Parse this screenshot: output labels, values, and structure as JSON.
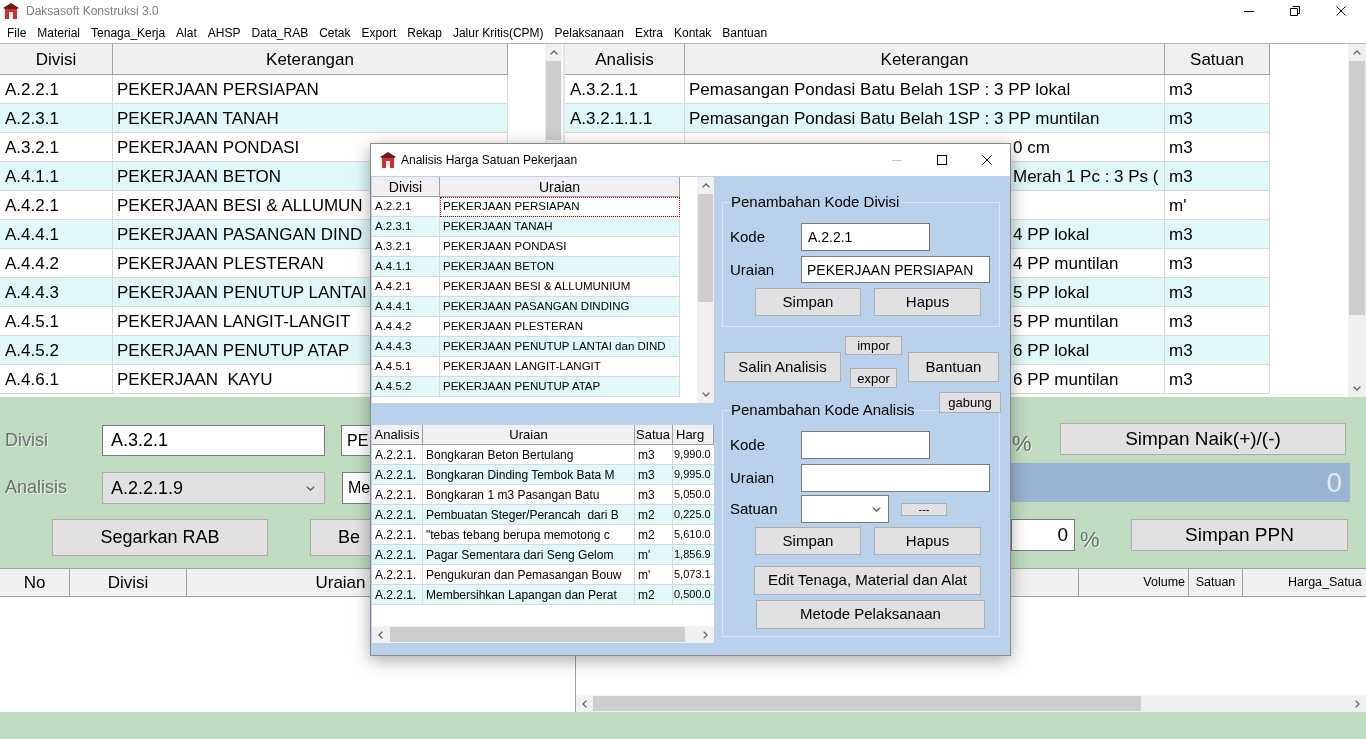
{
  "window": {
    "title": "Daksasoft Konstruksi 3.0"
  },
  "menu": [
    "File",
    "Material",
    "Tenaga_Kerja",
    "Alat",
    "AHSP",
    "Data_RAB",
    "Cetak",
    "Export",
    "Rekap",
    "Jalur Kritis(CPM)",
    "Pelaksanaan",
    "Extra",
    "Kontak",
    "Bantuan"
  ],
  "divisi_table": {
    "columns": [
      "Divisi",
      "Keterangan"
    ],
    "rows": [
      {
        "divisi": "A.2.2.1",
        "keterangan": "PEKERJAAN PERSIAPAN"
      },
      {
        "divisi": "A.2.3.1",
        "keterangan": "PEKERJAAN TANAH"
      },
      {
        "divisi": "A.3.2.1",
        "keterangan": "PEKERJAAN PONDASI"
      },
      {
        "divisi": "A.4.1.1",
        "keterangan": "PEKERJAAN BETON"
      },
      {
        "divisi": "A.4.2.1",
        "keterangan": "PEKERJAAN BESI & ALLUMUN"
      },
      {
        "divisi": "A.4.4.1",
        "keterangan": "PEKERJAAN PASANGAN DIND"
      },
      {
        "divisi": "A.4.4.2",
        "keterangan": "PEKERJAAN PLESTERAN"
      },
      {
        "divisi": "A.4.4.3",
        "keterangan": "PEKERJAAN PENUTUP LANTAI"
      },
      {
        "divisi": "A.4.5.1",
        "keterangan": "PEKERJAAN LANGIT-LANGIT"
      },
      {
        "divisi": "A.4.5.2",
        "keterangan": "PEKERJAAN PENUTUP ATAP"
      },
      {
        "divisi": "A.4.6.1",
        "keterangan": "PEKERJAAN  KAYU"
      }
    ]
  },
  "analisis_table": {
    "columns": [
      "Analisis",
      "Keterangan",
      "Satuan"
    ],
    "rows": [
      {
        "analisis": "A.3.2.1.1",
        "keterangan": "Pemasangan Pondasi Batu Belah 1SP : 3 PP lokal",
        "satuan": "m3"
      },
      {
        "analisis": "A.3.2.1.1.1",
        "keterangan": "Pemasangan Pondasi Batu Belah 1SP : 3 PP muntilan",
        "satuan": "m3"
      },
      {
        "keterangan": "0 cm",
        "satuan": "m3"
      },
      {
        "keterangan": "Merah 1 Pc : 3 Ps (",
        "satuan": "m3"
      },
      {
        "satuan": "m'"
      },
      {
        "keterangan": "4 PP lokal",
        "satuan": "m3"
      },
      {
        "keterangan": "4 PP muntilan",
        "satuan": "m3"
      },
      {
        "keterangan": "5 PP lokal",
        "satuan": "m3"
      },
      {
        "keterangan": "5 PP muntilan",
        "satuan": "m3"
      },
      {
        "keterangan": "6 PP lokal",
        "satuan": "m3"
      },
      {
        "keterangan": "6 PP muntilan",
        "satuan": "m3"
      }
    ]
  },
  "rab_form": {
    "divisi_label": "Divisi",
    "divisi_code": "A.3.2.1",
    "divisi_name": "PE",
    "analisis_label": "Analisis",
    "analisis_code": "A.2.2.1.9",
    "analisis_name": "Me",
    "refresh_button": "Segarkan RAB",
    "button_2": "Be",
    "increase_unit": "%",
    "increase_button": "Simpan Naik(+)/(-)",
    "total": "0",
    "ppn_value": "0",
    "ppn_unit": "%",
    "ppn_button": "Simpan PPN"
  },
  "rab_table": {
    "left_columns": [
      "No",
      "Divisi",
      "Uraian"
    ],
    "right_columns": [
      "Volume",
      "Satuan",
      "Harga_Satua"
    ]
  },
  "dialog": {
    "title": "Analisis Harga Satuan Pekerjaan",
    "divisi_table": {
      "columns": [
        "Divisi",
        "Uraian"
      ],
      "rows": [
        {
          "divisi": "A.2.2.1",
          "uraian": "PEKERJAAN PERSIAPAN",
          "selected": true
        },
        {
          "divisi": "A.2.3.1",
          "uraian": "PEKERJAAN TANAH",
          "selected": false
        },
        {
          "divisi": "A.3.2.1",
          "uraian": "PEKERJAAN PONDASI",
          "selected": false
        },
        {
          "divisi": "A.4.1.1",
          "uraian": "PEKERJAAN BETON",
          "selected": false
        },
        {
          "divisi": "A.4.2.1",
          "uraian": "PEKERJAAN BESI & ALLUMUNIUM",
          "selected": false
        },
        {
          "divisi": "A.4.4.1",
          "uraian": "PEKERJAAN PASANGAN DINDING",
          "selected": false
        },
        {
          "divisi": "A.4.4.2",
          "uraian": "PEKERJAAN PLESTERAN",
          "selected": false
        },
        {
          "divisi": "A.4.4.3",
          "uraian": "PEKERJAAN PENUTUP LANTAI dan DIND",
          "selected": false
        },
        {
          "divisi": "A.4.5.1",
          "uraian": "PEKERJAAN LANGIT-LANGIT",
          "selected": false
        },
        {
          "divisi": "A.4.5.2",
          "uraian": "PEKERJAAN PENUTUP ATAP",
          "selected": false
        }
      ]
    },
    "analisis_table": {
      "columns": [
        "Analisis",
        "Uraian",
        "Satua",
        "Harg"
      ],
      "rows": [
        {
          "analisis": "A.2.2.1.",
          "uraian": "Bongkaran Beton Bertulang",
          "satuan": "m3",
          "harga": "9,990.0"
        },
        {
          "analisis": "A.2.2.1.",
          "uraian": "Bongkaran Dinding Tembok Bata M",
          "satuan": "m3",
          "harga": "9,995.0"
        },
        {
          "analisis": "A.2.2.1.",
          "uraian": "Bongkaran 1 m3 Pasangan Batu",
          "satuan": "m3",
          "harga": "5,050.0"
        },
        {
          "analisis": "A.2.2.1.",
          "uraian": "Pembuatan Steger/Perancah  dari B",
          "satuan": "m2",
          "harga": "0,225.0"
        },
        {
          "analisis": "A.2.2.1.",
          "uraian": "\"tebas tebang berupa memotong c",
          "satuan": "m2",
          "harga": "5,610.0"
        },
        {
          "analisis": "A.2.2.1.",
          "uraian": "Pagar Sementara dari Seng Gelom",
          "satuan": "m'",
          "harga": "1,856.9"
        },
        {
          "analisis": "A.2.2.1.",
          "uraian": "Pengukuran dan Pemasangan Bouw",
          "satuan": "m'",
          "harga": "5,073.1"
        },
        {
          "analisis": "A.2.2.1.",
          "uraian": "Membersihkan Lapangan dan Perat",
          "satuan": "m2",
          "harga": "0,500.0"
        }
      ]
    },
    "divisi_group": {
      "title": "Penambahan Kode Divisi",
      "kode_label": "Kode",
      "kode": "A.2.2.1",
      "uraian_label": "Uraian",
      "uraian": "PEKERJAAN PERSIAPAN",
      "save_button": "Simpan",
      "delete_button": "Hapus"
    },
    "copy_button": "Salin Analisis",
    "import_button": "impor",
    "export_button": "expor",
    "help_button": "Bantuan",
    "merge_button": "gabung",
    "analisis_group": {
      "title": "Penambahan Kode Analisis",
      "kode_label": "Kode",
      "uraian_label": "Uraian",
      "satuan_label": "Satuan",
      "more_button": "---",
      "save_button": "Simpan",
      "delete_button": "Hapus",
      "edit_button": "Edit Tenaga, Material dan Alat",
      "method_button": "Metode Pelaksanaan"
    }
  }
}
